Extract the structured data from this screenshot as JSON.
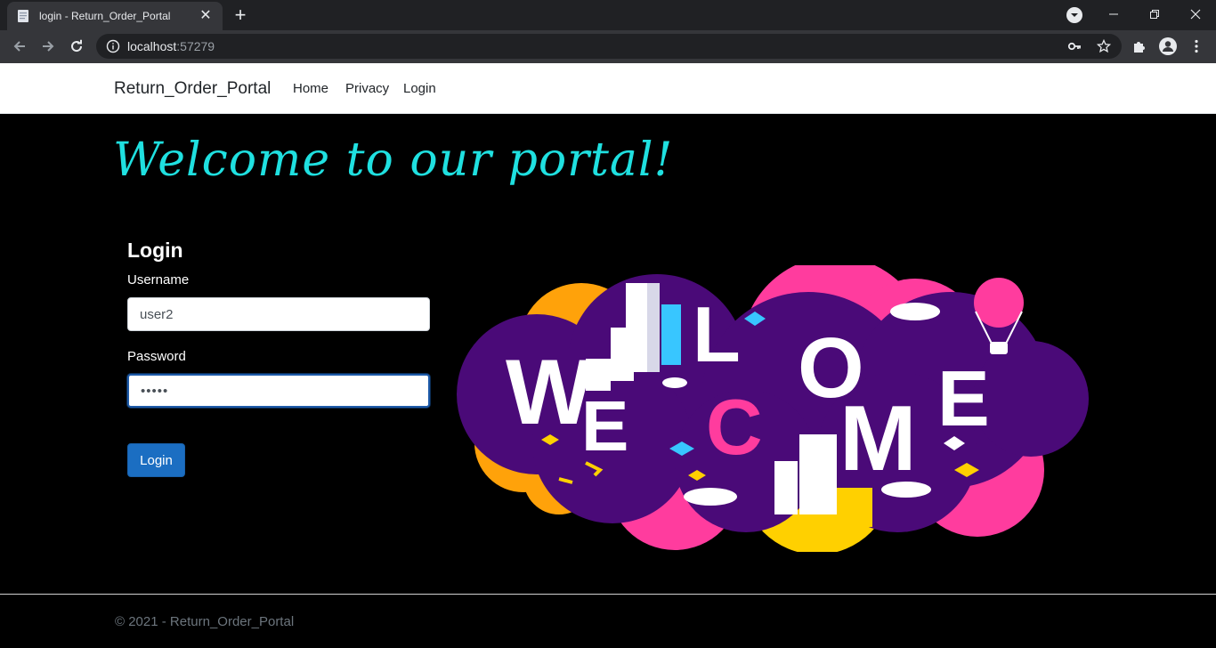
{
  "browser": {
    "tab_title": "login - Return_Order_Portal",
    "url_host": "localhost",
    "url_port": ":57279"
  },
  "navbar": {
    "brand": "Return_Order_Portal",
    "links": [
      "Home",
      "Privacy",
      "Login"
    ]
  },
  "main": {
    "headline": "Welcome to our portal!",
    "form": {
      "title": "Login",
      "username_label": "Username",
      "username_value": "user2",
      "password_label": "Password",
      "password_value": "•••••",
      "submit_label": "Login"
    },
    "hero_letters": [
      "W",
      "L",
      "O",
      "E",
      "C",
      "M",
      "E"
    ]
  },
  "footer": {
    "text": "© 2021 - Return_Order_Portal"
  },
  "colors": {
    "headline": "#1fe0e0",
    "button": "#1b6ec2",
    "hero_purple": "#4a0a78",
    "hero_pink": "#ff3c9e",
    "hero_orange": "#ffa20a",
    "hero_yellow": "#ffd000"
  }
}
